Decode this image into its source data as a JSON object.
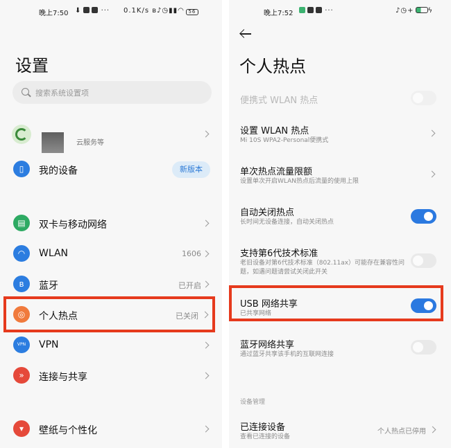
{
  "left": {
    "status": {
      "time": "晚上7:50",
      "speed": "0.1K/s",
      "battery": "56"
    },
    "title": "设置",
    "search": {
      "placeholder": "搜索系统设置项"
    },
    "account": {
      "subtitle": "云服务等"
    },
    "my_device": {
      "label": "我的设备",
      "badge": "新版本"
    },
    "items": [
      {
        "label": "双卡与移动网络",
        "value": ""
      },
      {
        "label": "WLAN",
        "value": "1606"
      },
      {
        "label": "蓝牙",
        "value": "已开启"
      },
      {
        "label": "个人热点",
        "value": "已关闭"
      },
      {
        "label": "VPN",
        "value": ""
      },
      {
        "label": "连接与共享",
        "value": ""
      },
      {
        "label": "壁纸与个性化",
        "value": ""
      }
    ],
    "icon_colors": {
      "sim": "#2eaa63",
      "wlan": "#2c7de0",
      "bluetooth": "#2c7de0",
      "hotspot": "#f07a3c",
      "vpn": "#2c7de0",
      "share": "#e5493a",
      "wallpaper": "#e5493a",
      "device": "#2c7de0"
    }
  },
  "right": {
    "status": {
      "time": "晚上7:52"
    },
    "title": "个人热点",
    "settings": [
      {
        "title": "便携式 WLAN 热点",
        "subtitle": "",
        "control": "toggle",
        "state": "disabled"
      },
      {
        "title": "设置 WLAN 热点",
        "subtitle": "Mi 10S WPA2-Personal便携式",
        "control": "chevron"
      },
      {
        "title": "单次热点流量限额",
        "subtitle": "设置单次开启WLAN热点后流量的使用上限",
        "control": "chevron"
      },
      {
        "title": "自动关闭热点",
        "subtitle": "长时间无设备连接，自动关闭热点",
        "control": "toggle",
        "state": "on"
      },
      {
        "title": "支持第6代技术标准",
        "subtitle": "老旧设备对第6代技术标准（802.11ax）可能存在兼容性问题，如遇问题请尝试关闭此开关",
        "control": "toggle",
        "state": "off"
      },
      {
        "title": "USB 网络共享",
        "subtitle": "已共享网络",
        "control": "toggle",
        "state": "on"
      },
      {
        "title": "蓝牙网络共享",
        "subtitle": "通过蓝牙共享该手机的互联网连接",
        "control": "toggle",
        "state": "off"
      }
    ],
    "section_label": "设备管理",
    "connected": {
      "title": "已连接设备",
      "subtitle": "查看已连接的设备",
      "value": "个人热点已停用"
    }
  },
  "highlight_color": "#e63a1d"
}
